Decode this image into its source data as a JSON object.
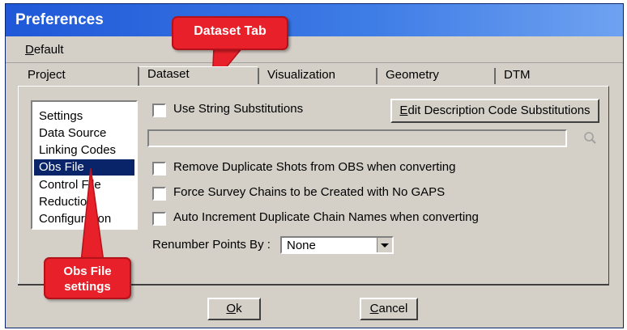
{
  "window": {
    "title": "Preferences"
  },
  "menu": {
    "items": [
      {
        "label": "Default"
      }
    ]
  },
  "tabs": [
    {
      "label": "Project",
      "active": false
    },
    {
      "label": "Dataset",
      "active": true
    },
    {
      "label": "Visualization",
      "active": false
    },
    {
      "label": "Geometry",
      "active": false
    },
    {
      "label": "DTM",
      "active": false
    }
  ],
  "sidebar": {
    "items": [
      {
        "label": "Settings"
      },
      {
        "label": "Data Source"
      },
      {
        "label": "Linking Codes"
      },
      {
        "label": "Obs File",
        "selected": true
      },
      {
        "label": "Control File"
      },
      {
        "label": "Reduction"
      },
      {
        "label": "Configuration"
      }
    ]
  },
  "dataset": {
    "use_string_substitutions": {
      "label": "Use String Substitutions",
      "checked": false
    },
    "edit_button_label": "Edit Description Code Substitutions",
    "substitution_text": {
      "value": ""
    },
    "options": [
      {
        "label": "Remove Duplicate Shots from OBS when converting",
        "checked": false
      },
      {
        "label": "Force Survey Chains to be Created with No GAPS",
        "checked": false
      },
      {
        "label": "Auto Increment Duplicate Chain Names when converting",
        "checked": false
      }
    ],
    "renumber_label": "Renumber Points By :",
    "renumber_value": "None"
  },
  "buttons": {
    "ok": "Ok",
    "cancel": "Cancel"
  },
  "callouts": {
    "dataset_tab": "Dataset Tab",
    "obs_line1": "Obs File",
    "obs_line2": "settings"
  },
  "colors": {
    "callout": "#e8202a",
    "selection": "#0a246a",
    "titlebar": "#1f58d8"
  }
}
